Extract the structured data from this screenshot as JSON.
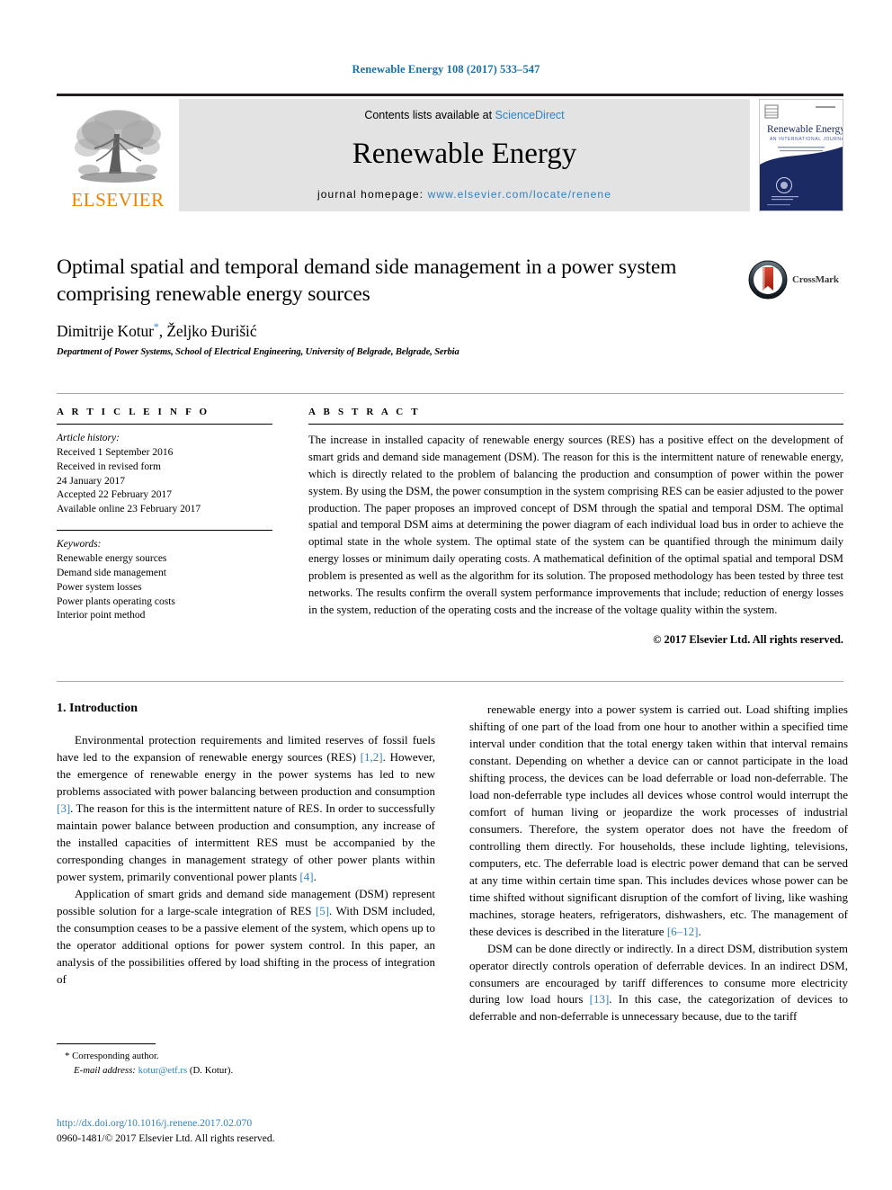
{
  "running_head": "Renewable Energy 108 (2017) 533–547",
  "masthead": {
    "publisher_name": "ELSEVIER",
    "contents_prefix": "Contents lists available at ",
    "contents_link": "ScienceDirect",
    "journal_name": "Renewable Energy",
    "homepage_prefix": "journal homepage: ",
    "homepage_url": "www.elsevier.com/locate/renene",
    "cover": {
      "title": "Renewable Energy",
      "subtitle": "AN INTERNATIONAL JOURNAL"
    }
  },
  "article": {
    "title": "Optimal spatial and temporal demand side management in a power system comprising renewable energy sources",
    "authors": "Dimitrije Kotur, Željko Đurišić",
    "author_first": "Dimitrije Kotur",
    "author_second": ", Željko Đurišić",
    "corresponding_marker": "*",
    "affiliation": "Department of Power Systems, School of Electrical Engineering, University of Belgrade, Belgrade, Serbia",
    "crossmark_label": "CrossMark"
  },
  "article_info": {
    "heading": "A R T I C L E   I N F O",
    "history_label": "Article history:",
    "history": [
      "Received 1 September 2016",
      "Received in revised form",
      "24 January 2017",
      "Accepted 22 February 2017",
      "Available online 23 February 2017"
    ],
    "keywords_label": "Keywords:",
    "keywords": [
      "Renewable energy sources",
      "Demand side management",
      "Power system losses",
      "Power plants operating costs",
      "Interior point method"
    ]
  },
  "abstract": {
    "heading": "A B S T R A C T",
    "text": "The increase in installed capacity of renewable energy sources (RES) has a positive effect on the development of smart grids and demand side management (DSM). The reason for this is the intermittent nature of renewable energy, which is directly related to the problem of balancing the production and consumption of power within the power system. By using the DSM, the power consumption in the system comprising RES can be easier adjusted to the power production. The paper proposes an improved concept of DSM through the spatial and temporal DSM. The optimal spatial and temporal DSM aims at determining the power diagram of each individual load bus in order to achieve the optimal state in the whole system. The optimal state of the system can be quantified through the minimum daily energy losses or minimum daily operating costs. A mathematical definition of the optimal spatial and temporal DSM problem is presented as well as the algorithm for its solution. The proposed methodology has been tested by three test networks. The results confirm the overall system performance improvements that include; reduction of energy losses in the system, reduction of the operating costs and the increase of the voltage quality within the system.",
    "copyright": "© 2017 Elsevier Ltd. All rights reserved."
  },
  "body": {
    "section_number_title": "1. Introduction",
    "left_paragraphs": [
      {
        "segments": [
          {
            "t": "Environmental protection requirements and limited reserves of fossil fuels have led to the expansion of renewable energy sources (RES) ",
            "k": "text"
          },
          {
            "t": "[1,2]",
            "k": "ref"
          },
          {
            "t": ". However, the emergence of renewable energy in the power systems has led to new problems associated with power balancing between production and consumption ",
            "k": "text"
          },
          {
            "t": "[3]",
            "k": "ref"
          },
          {
            "t": ". The reason for this is the intermittent nature of RES. In order to successfully maintain power balance between production and consumption, any increase of the installed capacities of intermittent RES must be accompanied by the corresponding changes in management strategy of other power plants within power system, primarily conventional power plants ",
            "k": "text"
          },
          {
            "t": "[4]",
            "k": "ref"
          },
          {
            "t": ".",
            "k": "text"
          }
        ]
      },
      {
        "segments": [
          {
            "t": "Application of smart grids and demand side management (DSM) represent possible solution for a large-scale integration of RES ",
            "k": "text"
          },
          {
            "t": "[5]",
            "k": "ref"
          },
          {
            "t": ". With DSM included, the consumption ceases to be a passive element of the system, which opens up to the operator additional options for power system control. In this paper, an analysis of the possibilities offered by load shifting in the process of integration of",
            "k": "text"
          }
        ]
      }
    ],
    "right_paragraphs": [
      {
        "segments": [
          {
            "t": "renewable energy into a power system is carried out. Load shifting implies shifting of one part of the load from one hour to another within a specified time interval under condition that the total energy taken within that interval remains constant. Depending on whether a device can or cannot participate in the load shifting process, the devices can be load deferrable or load non-deferrable. The load non-deferrable type includes all devices whose control would interrupt the comfort of human living or jeopardize the work processes of industrial consumers. Therefore, the system operator does not have the freedom of controlling them directly. For households, these include lighting, televisions, computers, etc. The deferrable load is electric power demand that can be served at any time within certain time span. This includes devices whose power can be time shifted without significant disruption of the comfort of living, like washing machines, storage heaters, refrigerators, dishwashers, etc. The management of these devices is described in the literature ",
            "k": "text"
          },
          {
            "t": "[6–12]",
            "k": "ref"
          },
          {
            "t": ".",
            "k": "text"
          }
        ]
      },
      {
        "segments": [
          {
            "t": "DSM can be done directly or indirectly. In a direct DSM, distribution system operator directly controls operation of deferrable devices. In an indirect DSM, consumers are encouraged by tariff differences to consume more electricity during low load hours ",
            "k": "text"
          },
          {
            "t": "[13]",
            "k": "ref"
          },
          {
            "t": ". In this case, the categorization of devices to deferrable and non-deferrable is unnecessary because, due to the tariff",
            "k": "text"
          }
        ]
      }
    ]
  },
  "footer": {
    "corresponding_star": "*",
    "corresponding_label": "Corresponding author.",
    "email_label": "E-mail address:",
    "email": "kotur@etf.rs",
    "email_owner": "(D. Kotur).",
    "doi_url": "http://dx.doi.org/10.1016/j.renene.2017.02.070",
    "issn_line": "0960-1481/© 2017 Elsevier Ltd. All rights reserved."
  },
  "colors": {
    "link_blue": "#2f83c5",
    "running_head_blue": "#1a72ad",
    "elsevier_orange": "#ef8200",
    "banner_gray": "#e3e3e3",
    "cover_navy": "#1b2a63",
    "crossmark_red": "#b81f10"
  }
}
